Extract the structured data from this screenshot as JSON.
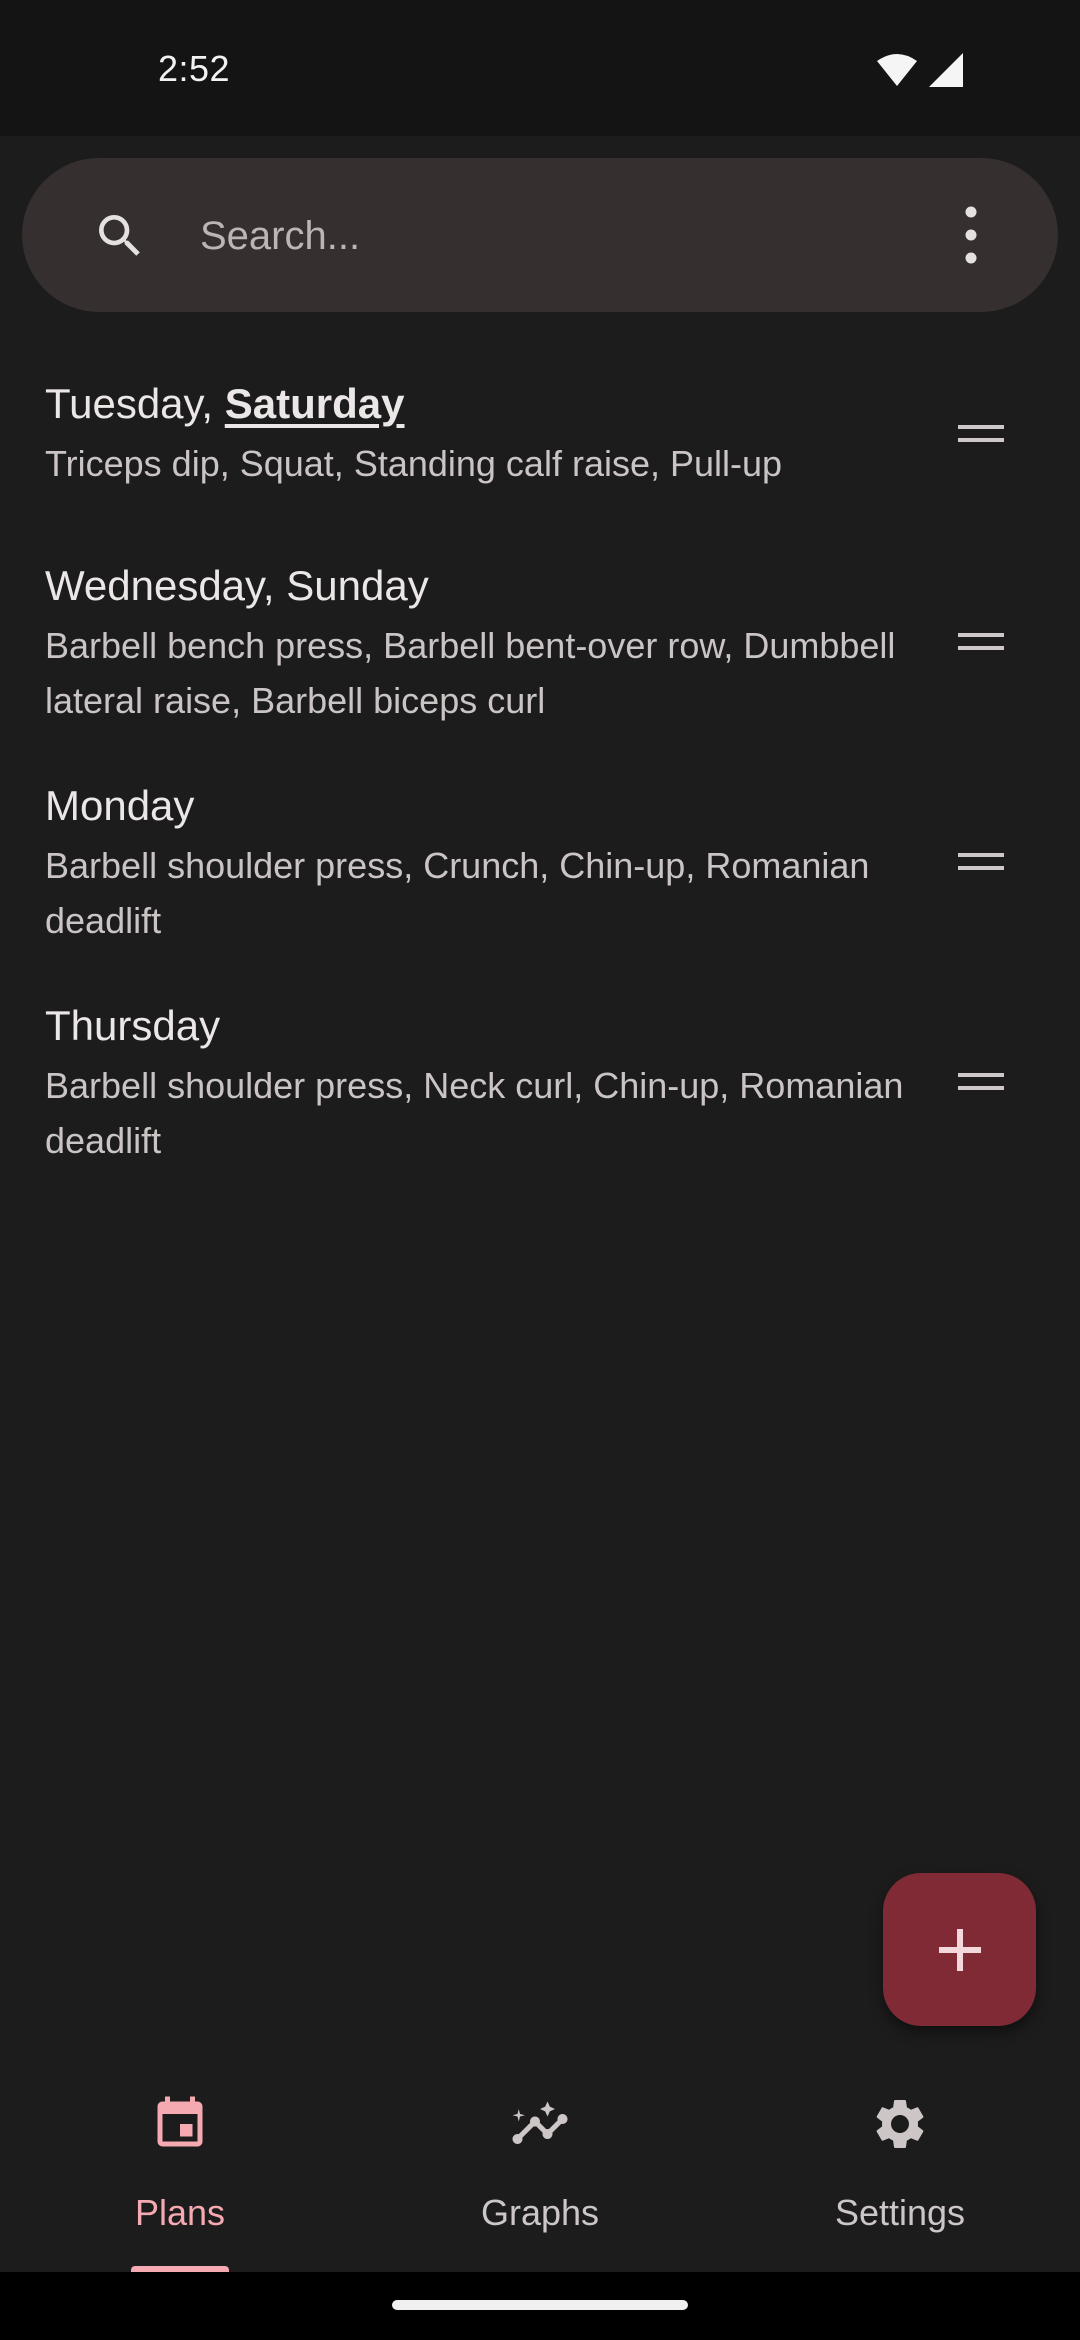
{
  "status_bar": {
    "time": "2:52",
    "icons": [
      "wifi-icon",
      "cellular-signal-icon"
    ]
  },
  "search": {
    "placeholder": "Search...",
    "value": "",
    "icon": "search-icon",
    "menu_icon": "more-vert-icon"
  },
  "plans": [
    {
      "days": "Tuesday, ",
      "today": "Saturday",
      "exercises": "Triceps dip, Squat, Standing calf raise, Pull-up"
    },
    {
      "days": "Wednesday, Sunday",
      "today": "",
      "exercises": "Barbell bench press, Barbell bent-over row, Dumbbell lateral raise, Barbell biceps curl"
    },
    {
      "days": "Monday",
      "today": "",
      "exercises": "Barbell shoulder press, Crunch, Chin-up, Romanian deadlift"
    },
    {
      "days": "Thursday",
      "today": "",
      "exercises": "Barbell shoulder press, Neck curl, Chin-up, Romanian deadlift"
    }
  ],
  "fab": {
    "icon": "add-icon"
  },
  "bottom_nav": {
    "items": [
      {
        "label": "Plans",
        "icon": "calendar-icon",
        "active": true
      },
      {
        "label": "Graphs",
        "icon": "insights-icon",
        "active": false
      },
      {
        "label": "Settings",
        "icon": "gear-icon",
        "active": false
      }
    ]
  },
  "colors": {
    "background": "#1c1c1d",
    "search_bar": "#362f2f",
    "accent": "#f5a9b0",
    "fab": "#7f2a35"
  }
}
